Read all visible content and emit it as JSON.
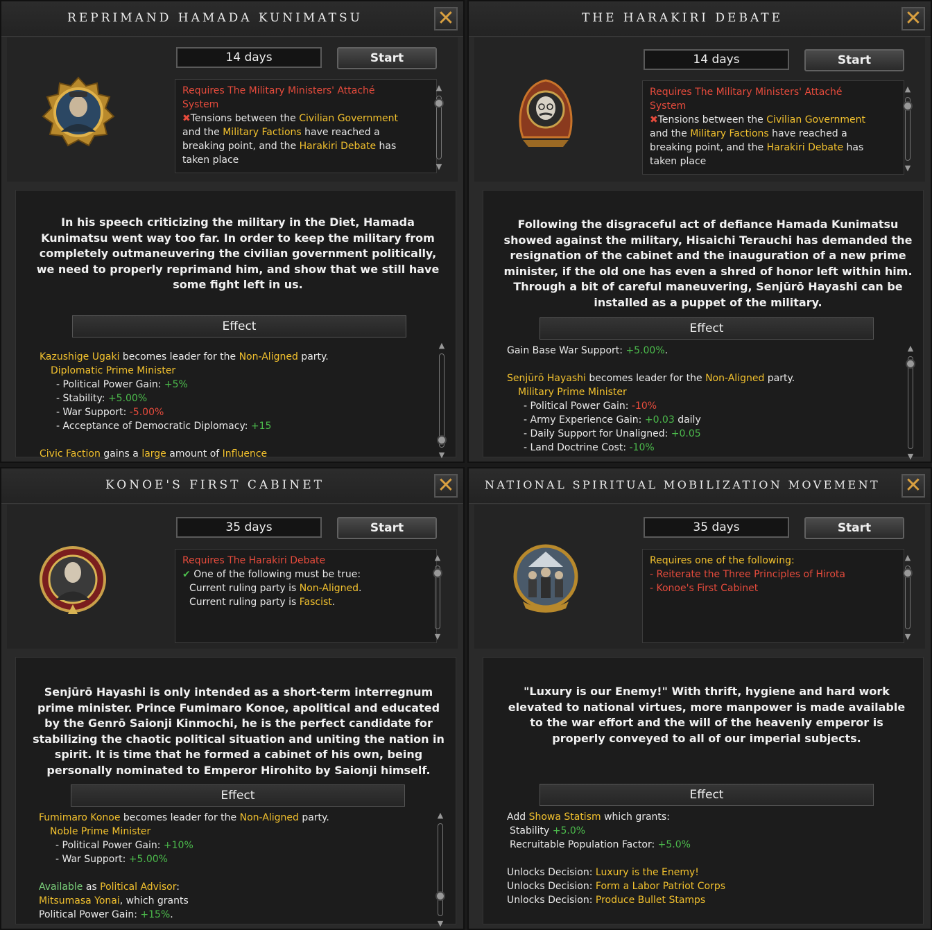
{
  "panels": [
    {
      "title": "Reprimand Hamada Kunimatsu",
      "days": "14 days",
      "start": "Start",
      "portrait": "general-medal-portrait",
      "req": {
        "l1": "Requires The Military Ministers' Attaché",
        "l2": "System",
        "l3a": "Tensions between the ",
        "l3b": "Civilian Government",
        "l4a": "and the ",
        "l4b": "Military Factions",
        "l4c": " have reached a",
        "l5a": "breaking point, and the ",
        "l5b": "Harakiri Debate",
        "l5c": " has",
        "l6": "taken place"
      },
      "desc": "In his speech criticizing the military in the Diet, Hamada Kunimatsu went way too far. In order to keep the military from completely outmaneuvering the civilian government politically, we need to properly reprimand him, and show that we still have some fight left in us.",
      "effect_label": "Effect",
      "effects": {
        "e1a": "Kazushige Ugaki",
        "e1b": " becomes leader for the ",
        "e1c": "Non-Aligned",
        "e1d": " party.",
        "e2": "Diplomatic Prime Minister",
        "e3a": "- Political Power Gain: ",
        "e3b": "+5%",
        "e4a": "- Stability: ",
        "e4b": "+5.00%",
        "e5a": "- War Support: ",
        "e5b": "-5.00%",
        "e6a": "- Acceptance of Democratic Diplomacy: ",
        "e6b": "+15",
        "e7a": "Civic Faction",
        "e7b": " gains a ",
        "e7c": "large",
        "e7d": " amount of ",
        "e7e": "Influence"
      }
    },
    {
      "title": "The Harakiri Debate",
      "days": "14 days",
      "start": "Start",
      "portrait": "scholar-medal-portrait",
      "req": {
        "l1": "Requires The Military Ministers' Attaché",
        "l2": "System",
        "l3a": "Tensions between the ",
        "l3b": "Civilian Government",
        "l4a": "and the ",
        "l4b": "Military Factions",
        "l4c": " have reached a",
        "l5a": "breaking point, and the ",
        "l5b": "Harakiri Debate",
        "l5c": " has",
        "l6": "taken place"
      },
      "desc": "Following the disgraceful act of defiance Hamada Kunimatsu showed against the military, Hisaichi Terauchi has demanded the resignation of the cabinet and the inauguration of a new prime minister, if the old one has even a shred of honor left within him. Through a bit of careful maneuvering, Senjūrō Hayashi can be installed as a puppet of the military.",
      "effect_label": "Effect",
      "effects": {
        "e0a": "Gain Base War Support: ",
        "e0b": "+5.00%",
        "e0c": ".",
        "e1a": "Senjūrō Hayashi",
        "e1b": " becomes leader for the ",
        "e1c": "Non-Aligned",
        "e1d": " party.",
        "e2": "Military Prime Minister",
        "e3a": "- Political Power Gain: ",
        "e3b": "-10%",
        "e4a": "- Army Experience Gain: ",
        "e4b": "+0.03",
        "e4c": " daily",
        "e5a": "- Daily Support for Unaligned: ",
        "e5b": "+0.05",
        "e6a": "- Land Doctrine Cost: ",
        "e6b": "-10%"
      }
    },
    {
      "title": "Konoe's First Cabinet",
      "days": "35 days",
      "start": "Start",
      "portrait": "officer-medal-portrait",
      "req": {
        "l1": "Requires The Harakiri Debate",
        "l2": "One of the following must be true:",
        "l3a": "Current ruling party is ",
        "l3b": "Non-Aligned",
        "l3c": ".",
        "l4a": "Current ruling party is ",
        "l4b": "Fascist",
        "l4c": "."
      },
      "desc": "Senjūrō Hayashi is only intended as a short-term interregnum prime minister. Prince Fumimaro Konoe, apolitical and educated by the Genrō Saionji Kinmochi, he is the perfect candidate for stabilizing the chaotic political situation and uniting the nation in spirit. It is time that he formed a cabinet of his own, being personally nominated to Emperor Hirohito by Saionji himself.",
      "effect_label": "Effect",
      "effects": {
        "e1a": "Fumimaro Konoe",
        "e1b": " becomes leader for the ",
        "e1c": "Non-Aligned",
        "e1d": " party.",
        "e2": "Noble Prime Minister",
        "e3a": "- Political Power Gain: ",
        "e3b": "+10%",
        "e4a": "- War Support: ",
        "e4b": "+5.00%",
        "e5a": "Available",
        "e5b": " as ",
        "e5c": "Political Advisor",
        "e5d": ":",
        "e6a": "Mitsumasa Yonai",
        "e6b": ", which grants",
        "e7a": "Political Power Gain: ",
        "e7b": "+15%",
        "e7c": "."
      }
    },
    {
      "title": "National Spiritual Mobilization Movement",
      "days": "35 days",
      "start": "Start",
      "portrait": "soldiers-medal-portrait",
      "req": {
        "l1": "Requires one of the following:",
        "l2": "- Reiterate the Three Principles of Hirota",
        "l3": "- Konoe's First Cabinet"
      },
      "desc": "\"Luxury is our Enemy!\" With thrift, hygiene and hard work elevated to national virtues, more manpower is made available to the war effort and the will of the heavenly emperor is properly conveyed to all of our imperial subjects.",
      "effect_label": "Effect",
      "effects": {
        "e1a": "Add ",
        "e1b": "Showa Statism",
        "e1c": " which grants:",
        "e2a": "Stability ",
        "e2b": "+5.0%",
        "e3a": "Recruitable Population Factor: ",
        "e3b": "+5.0%",
        "e4a": "Unlocks Decision: ",
        "e4b": "Luxury is the Enemy!",
        "e5a": "Unlocks Decision: ",
        "e5b": "Form a Labor Patriot Corps",
        "e6a": "Unlocks Decision: ",
        "e6b": "Produce Bullet Stamps"
      }
    }
  ],
  "close_glyph": "✕",
  "cross_glyph": "✖",
  "check_glyph": "✔",
  "colors": {
    "yellow": "#f2c12e",
    "red": "#e64b3c",
    "green": "#4cbc4c",
    "close": "#d9a040"
  }
}
